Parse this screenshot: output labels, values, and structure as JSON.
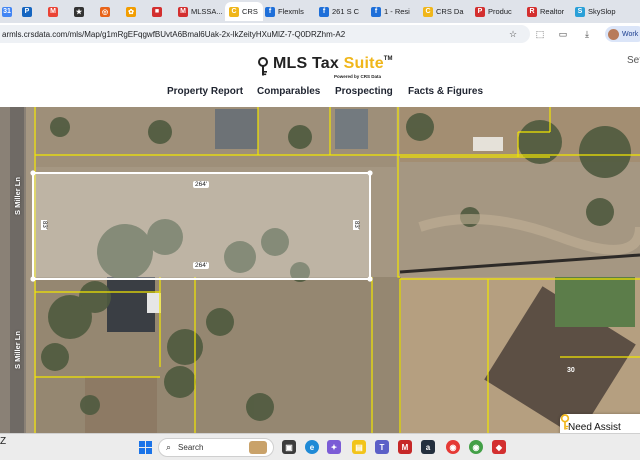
{
  "browser": {
    "tabs": [
      {
        "label": "",
        "icon": "google-calendar-icon",
        "color": "#4285f4",
        "glyph": "31"
      },
      {
        "label": "",
        "icon": "parking-icon",
        "color": "#1565c0",
        "glyph": "P"
      },
      {
        "label": "",
        "icon": "gmail-icon",
        "color": "#ea4335",
        "glyph": "M"
      },
      {
        "label": "",
        "icon": "star-icon",
        "color": "#333333",
        "glyph": "★"
      },
      {
        "label": "",
        "icon": "app-icon",
        "color": "#e8641a",
        "glyph": "◎"
      },
      {
        "label": "",
        "icon": "app-icon",
        "color": "#f29d00",
        "glyph": "✿"
      },
      {
        "label": "",
        "icon": "app-icon",
        "color": "#d32f2f",
        "glyph": "■"
      },
      {
        "label": "MLSSA...",
        "icon": "app-icon",
        "color": "#d32f2f",
        "glyph": "M"
      },
      {
        "label": "CRS",
        "icon": "crs-icon",
        "color": "#f0b61a",
        "glyph": "C"
      },
      {
        "label": "Flexmls",
        "icon": "flexmls-icon",
        "color": "#1e6fd9",
        "glyph": "f"
      },
      {
        "label": "261 S C",
        "icon": "flexmls-icon",
        "color": "#1e6fd9",
        "glyph": "f"
      },
      {
        "label": "1 - Resi",
        "icon": "flexmls-icon",
        "color": "#1e6fd9",
        "glyph": "f"
      },
      {
        "label": "CRS Da",
        "icon": "crs-icon",
        "color": "#f0b61a",
        "glyph": "C"
      },
      {
        "label": "Produc",
        "icon": "app-icon",
        "color": "#d32f2f",
        "glyph": "P"
      },
      {
        "label": "Realtor",
        "icon": "realtor-icon",
        "color": "#d32f2f",
        "glyph": "R"
      },
      {
        "label": "SkySlop",
        "icon": "skyslope-icon",
        "color": "#2aa0d8",
        "glyph": "S"
      }
    ],
    "active_tab_close": "✕",
    "url": "armls.crsdata.com/mls/Map/g1mRgEFqgwfBUvtA6Bmal6Uak-2x-lkZeityHXuMlZ-7-Q0DRZhm-A2",
    "profile_label": "Work"
  },
  "site": {
    "logo_text_main": "MLS Tax",
    "logo_text_accent": "Suite",
    "logo_tm": "TM",
    "logo_powered": "Powered by CRS Data",
    "settings_link": "Set",
    "nav": [
      "Property Report",
      "Comparables",
      "Prospecting",
      "Facts & Figures"
    ]
  },
  "map": {
    "street_labels": [
      "S Miller Ln",
      "S Miller Ln"
    ],
    "dimensions": {
      "top": "264'",
      "bottom": "264'",
      "left": "83'",
      "right": "83'"
    },
    "house_number": "30",
    "assist_label": "Need Assist"
  },
  "taskbar": {
    "left_text": "Z",
    "search_placeholder": "Search"
  }
}
